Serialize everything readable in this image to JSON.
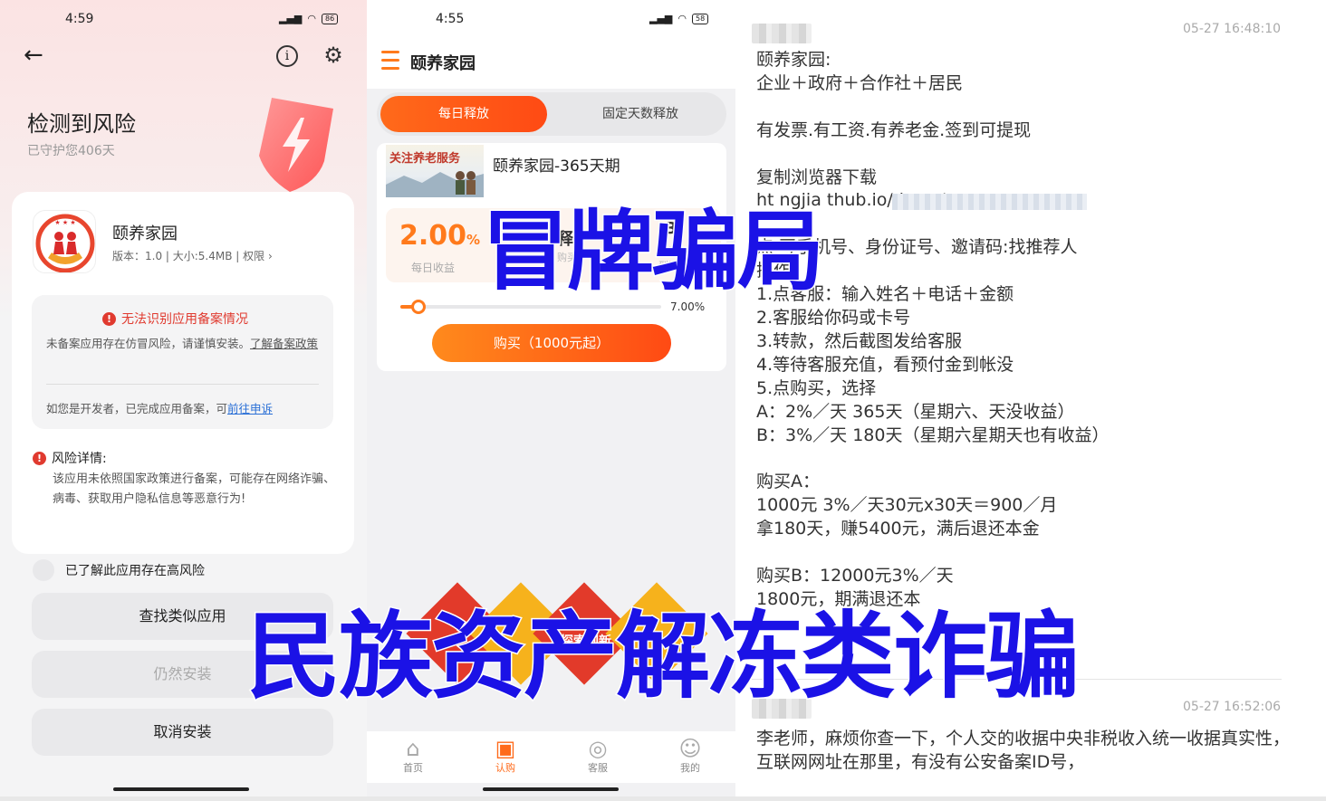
{
  "panel1": {
    "status": {
      "time": "4:59",
      "battery": "86"
    },
    "title": "检测到风险",
    "subtitle": "已守护您406天",
    "app": {
      "name": "颐养家园",
      "meta": "版本：1.0 | 大小:5.4MB | 权限 ›"
    },
    "warning": {
      "title": "无法识别应用备案情况",
      "text_before": "未备案应用存在仿冒风险，请谨慎安装。",
      "text_link": "了解备案政策",
      "dev_text": "如您是开发者，已完成应用备案，可",
      "dev_link": "前往申诉"
    },
    "risk": {
      "title": "风险详情:",
      "text": "该应用未依照国家政策进行备案，可能存在网络诈骗、病毒、获取用户隐私信息等恶意行为!"
    },
    "checkbox_label": "已了解此应用存在高风险",
    "buttons": {
      "find_similar": "查找类似应用",
      "install_anyway": "仍然安装",
      "cancel": "取消安装"
    }
  },
  "panel2": {
    "status": {
      "time": "4:55",
      "battery": "58"
    },
    "app_title": "颐养家园",
    "tabs": [
      "每日释放",
      "固定天数释放"
    ],
    "product": {
      "thumb_text": "关注养老服务",
      "name": "颐养家园-365天期",
      "rate": "2.00",
      "rate_unit": "%",
      "rate_label": "每日收益",
      "mid_big": "释",
      "mid_small": "购买",
      "right_big": "3",
      "right_small": "周期到期",
      "slider_value": "7.00%",
      "buy_label": "购买（1000元起）"
    },
    "banner_labels": [
      "探索创新"
    ],
    "tabbar": [
      {
        "label": "首页",
        "icon": "home-icon"
      },
      {
        "label": "认购",
        "icon": "subscribe-icon"
      },
      {
        "label": "客服",
        "icon": "headset-icon"
      },
      {
        "label": "我的",
        "icon": "user-icon"
      }
    ]
  },
  "panel3": {
    "msg1_time": "05-27 16:48:10",
    "msg1": "颐养家园:\n企业＋政府＋合作社＋居民\n\n有发票.有工资.有养老金.签到可提现\n\n复制浏览器下载\nht       ngjia                           thub.io/down/\n\n点                写手机号、身份证号、邀请码:找推荐人\n操作:\n1.点客服：输入姓名＋电话＋金额\n2.客服给你码或卡号\n3.转款，然后截图发给客服\n4.等待客服充值，看预付金到帐没\n5.点购买，选择\nA：2%／天  365天（星期六、天没收益）\nB：3%／天  180天（星期六星期天也有收益）\n\n购买A：\n1000元 3%／天30元x30天＝900／月\n拿180天，赚5400元，满后退还本金\n\n购买B：12000元3%／天\n                                                                           1800元，期满退还本",
    "msg2_time": "05-27 16:52:06",
    "msg2": "李老师，麻烦你查一下，个人交的收据中央非税收入统一收据真实性，互联网网址在那里，有没有公安备案ID号，"
  },
  "overlay": {
    "top": "冒牌骗局",
    "bottom": "民族资产解冻类诈骗"
  },
  "colors": {
    "accent_orange": "#ff6a1a",
    "warning_red": "#e03a2f",
    "overlay_blue": "#1b12e6",
    "link_blue": "#2a6fd6"
  }
}
